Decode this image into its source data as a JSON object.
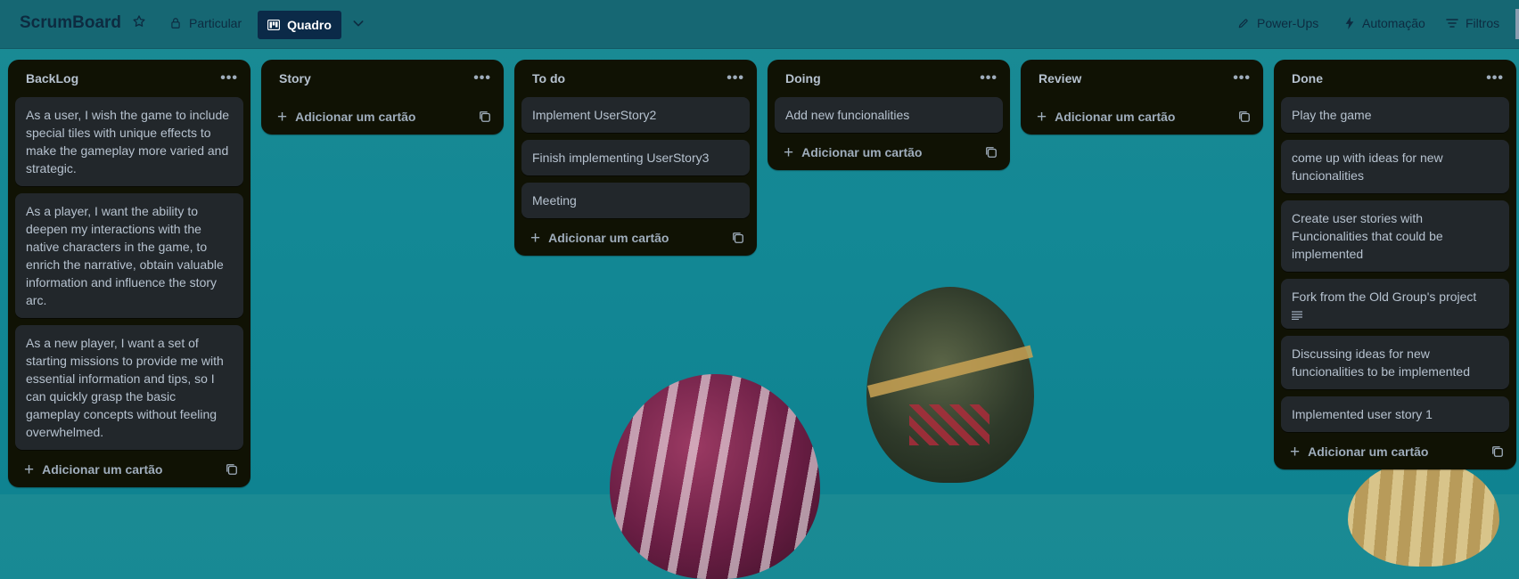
{
  "header": {
    "board_title": "ScrumBoard",
    "visibility_label": "Particular",
    "view_label": "Quadro",
    "powerups_label": "Power-Ups",
    "automation_label": "Automação",
    "filters_label": "Filtros"
  },
  "icons": {
    "star": "star-icon",
    "lock": "lock-icon",
    "board": "board-icon",
    "chevron": "chevron-down-icon",
    "rocket": "rocket-icon",
    "bolt": "lightning-icon",
    "filter": "filter-icon",
    "more": "more-icon",
    "plus": "plus-icon",
    "template": "card-template-icon",
    "description": "description-icon"
  },
  "lists": [
    {
      "title": "BackLog",
      "cards": [
        {
          "text": "As a user, I wish the game to include special tiles with unique effects to make the gameplay more varied and strategic."
        },
        {
          "text": "As a player, I want the ability to deepen my interactions with the native characters in the game, to enrich the narrative, obtain valuable information and influence the story arc."
        },
        {
          "text": "As a new player, I want a set of starting missions to provide me with essential information and tips, so I can quickly grasp the basic gameplay concepts without feeling overwhelmed."
        }
      ],
      "add_label": "Adicionar um cartão"
    },
    {
      "title": "Story",
      "cards": [],
      "add_label": "Adicionar um cartão"
    },
    {
      "title": "To do",
      "cards": [
        {
          "text": "Implement UserStory2"
        },
        {
          "text": "Finish implementing UserStory3"
        },
        {
          "text": "Meeting"
        }
      ],
      "add_label": "Adicionar um cartão"
    },
    {
      "title": "Doing",
      "cards": [
        {
          "text": "Add new funcionalities"
        }
      ],
      "add_label": "Adicionar um cartão"
    },
    {
      "title": "Review",
      "cards": [],
      "add_label": "Adicionar um cartão"
    },
    {
      "title": "Done",
      "cards": [
        {
          "text": "Play the game"
        },
        {
          "text": "come up with ideas for new funcionalities"
        },
        {
          "text": "Create user stories with Funcionalities that could be implemented"
        },
        {
          "text": "Fork from the Old Group's project",
          "has_description": true
        },
        {
          "text": "Discussing ideas for new funcionalities to be implemented"
        },
        {
          "text": "Implemented user story 1"
        }
      ],
      "add_label": "Adicionar um cartão"
    }
  ],
  "colors": {
    "list_bg": "#101204",
    "card_bg": "#22272b",
    "text": "#b6c2cf",
    "header_text": "#0d2b40",
    "active_view_bg": "#0b2a48"
  }
}
